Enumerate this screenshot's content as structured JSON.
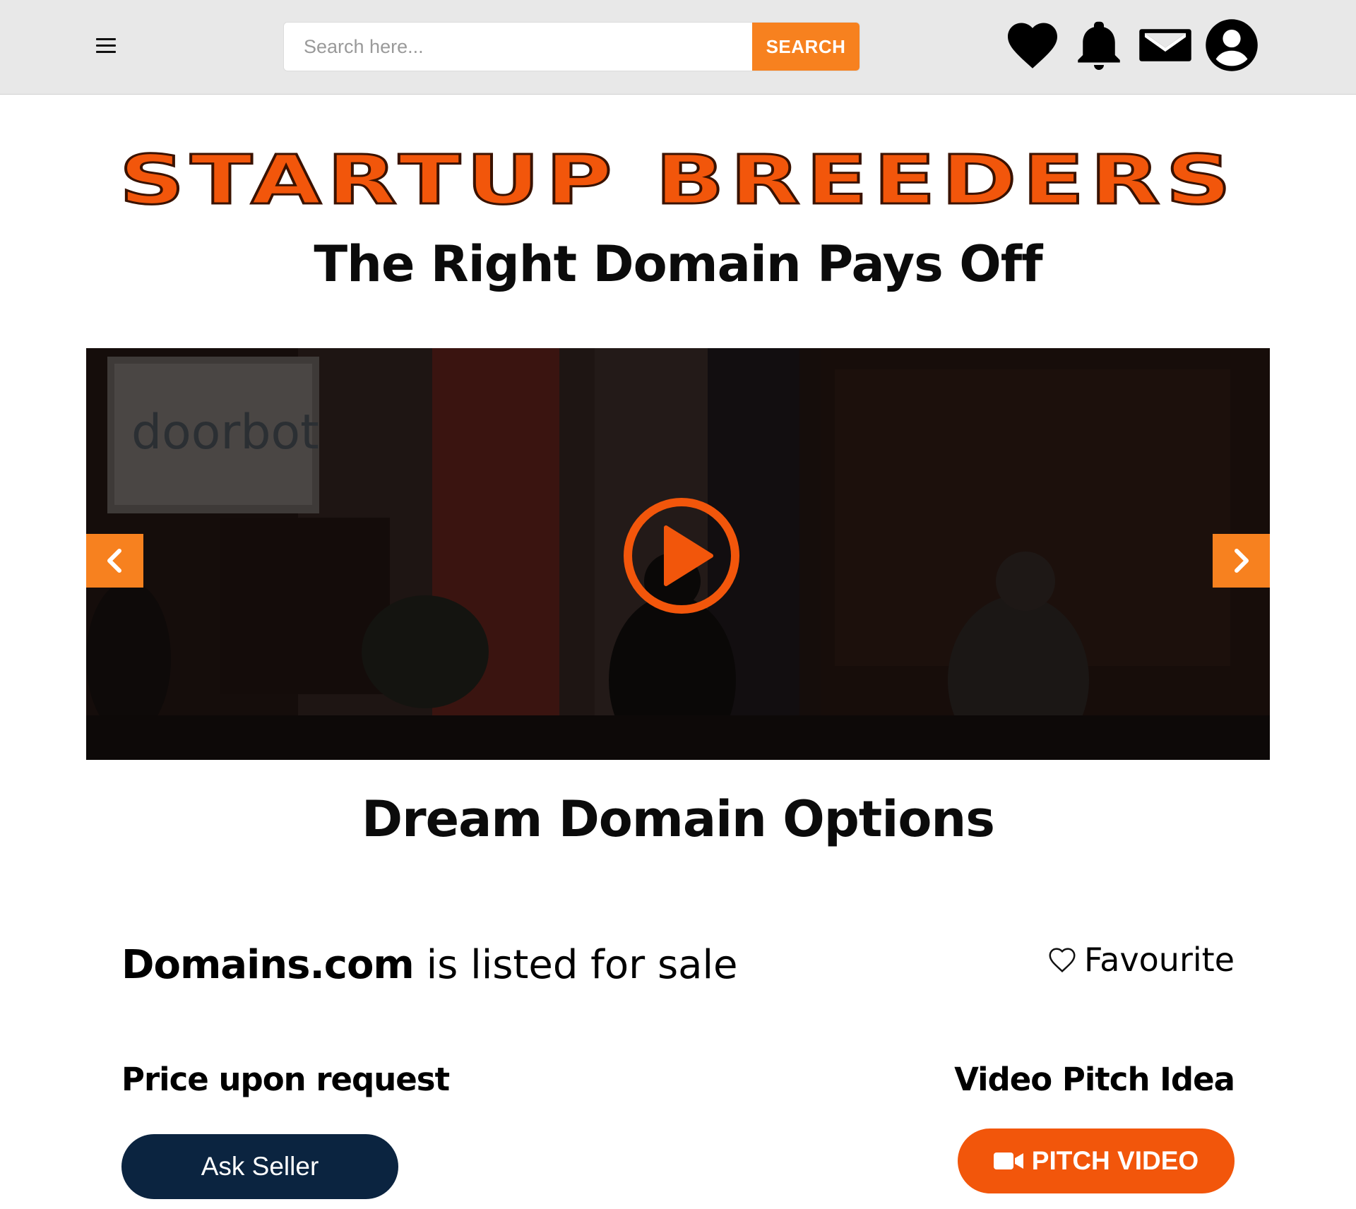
{
  "header": {
    "menu_icon": "hamburger-menu-icon",
    "search": {
      "placeholder": "Search here...",
      "value": "",
      "button_label": "SEARCH"
    },
    "icons": [
      "heart-icon",
      "bell-icon",
      "mail-icon",
      "user-account-icon"
    ]
  },
  "hero": {
    "brand": "STARTUP BREEDERS",
    "tagline": "The Right Domain Pays Off"
  },
  "video": {
    "screen_text": "doorbot",
    "prev_icon": "chevron-left-icon",
    "next_icon": "chevron-right-icon",
    "play_icon": "play-icon"
  },
  "section_title": "Dream Domain Options",
  "listing": {
    "domain": "Domains.com",
    "status_text": " is listed for sale",
    "favourite_label": "Favourite",
    "price_text": "Price upon request",
    "pitch_label": "Video Pitch Idea",
    "ask_seller_label": "Ask Seller",
    "pitch_video_label": "PITCH VIDEO"
  },
  "colors": {
    "accent_orange": "#f7811f",
    "brand_orange": "#f2560b",
    "navy": "#0b2440",
    "header_bg": "#e8e8e8"
  }
}
